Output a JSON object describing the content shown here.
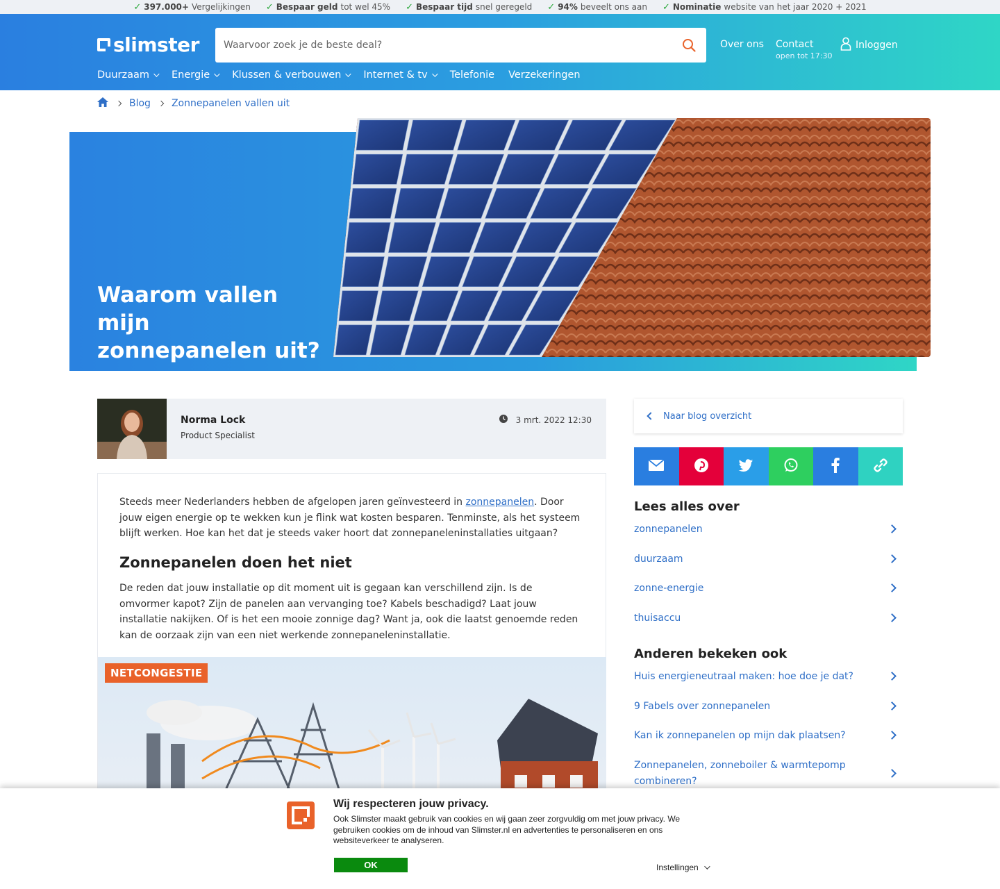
{
  "usp": [
    {
      "bold": "397.000+",
      "text": "Vergelijkingen"
    },
    {
      "bold": "Bespaar geld",
      "text": "tot wel 45%"
    },
    {
      "bold": "Bespaar tijd",
      "text": "snel geregeld"
    },
    {
      "bold": "94%",
      "text": "beveelt ons aan"
    },
    {
      "bold": "Nominatie",
      "text": "website van het jaar 2020 + 2021"
    }
  ],
  "header": {
    "logo": "slimster",
    "search_placeholder": "Waarvoor zoek je de beste deal?",
    "about": "Over ons",
    "contact": "Contact",
    "contact_sub": "open tot 17:30",
    "login": "Inloggen"
  },
  "nav": [
    {
      "label": "Duurzaam",
      "dropdown": true
    },
    {
      "label": "Energie",
      "dropdown": true
    },
    {
      "label": "Klussen & verbouwen",
      "dropdown": true
    },
    {
      "label": "Internet & tv",
      "dropdown": true
    },
    {
      "label": "Telefonie",
      "dropdown": false
    },
    {
      "label": "Verzekeringen",
      "dropdown": false
    }
  ],
  "breadcrumb": {
    "blog": "Blog",
    "current": "Zonnepanelen vallen uit"
  },
  "hero": {
    "title": "Waarom vallen mijn zonnepanelen uit?"
  },
  "author": {
    "name": "Norma Lock",
    "role": "Product Specialist",
    "date": "3 mrt. 2022 12:30"
  },
  "article": {
    "p1_before": "Steeds meer Nederlanders hebben de afgelopen jaren geïnvesteerd in ",
    "p1_link": "zonnepanelen",
    "p1_after": ". Door jouw eigen energie op te wekken kun je flink wat kosten besparen. Tenminste, als het systeem blijft werken. Hoe kan het dat je steeds vaker hoort dat zonnepaneleninstallaties uitgaan?",
    "h2": "Zonnepanelen doen het niet",
    "p2": "De reden dat jouw installatie op dit moment uit is gegaan kan verschillend zijn. Is de omvormer kapot? Zijn de panelen aan vervanging toe? Kabels beschadigd? Laat jouw installatie nakijken. Of is het een mooie zonnige dag? Want ja, ook die laatst genoemde reden kan de oorzaak zijn van een niet werkende zonnepaneleninstallatie.",
    "image_label": "NETCONGESTIE"
  },
  "sidebar": {
    "back": "Naar blog overzicht",
    "share": [
      {
        "icon": "email-icon",
        "color": "#2a7ee0"
      },
      {
        "icon": "pinterest-icon",
        "color": "#e4003a"
      },
      {
        "icon": "twitter-icon",
        "color": "#2a9ee8"
      },
      {
        "icon": "whatsapp-icon",
        "color": "#2ecf5f"
      },
      {
        "icon": "facebook-icon",
        "color": "#2a7ee0"
      },
      {
        "icon": "link-icon",
        "color": "#2fd2c1"
      }
    ],
    "read_all_title": "Lees alles over",
    "read_all": [
      "zonnepanelen",
      "duurzaam",
      "zonne-energie",
      "thuisaccu"
    ],
    "others_title": "Anderen bekeken ook",
    "others": [
      "Huis energieneutraal maken: hoe doe je dat?",
      "9 Fabels over zonnepanelen",
      "Kan ik zonnepanelen op mijn dak plaatsen?",
      "Zonnepanelen, zonneboiler & warmtepomp combineren?"
    ]
  },
  "cookie": {
    "title": "Wij respecteren jouw privacy.",
    "text": "Ook Slimster maakt gebruik van cookies en wij gaan zeer zorgvuldig om met jouw privacy. We gebruiken cookies om de inhoud van Slimster.nl en advertenties te personaliseren en ons websiteverkeer te analyseren.",
    "ok": "OK",
    "settings": "Instellingen"
  }
}
